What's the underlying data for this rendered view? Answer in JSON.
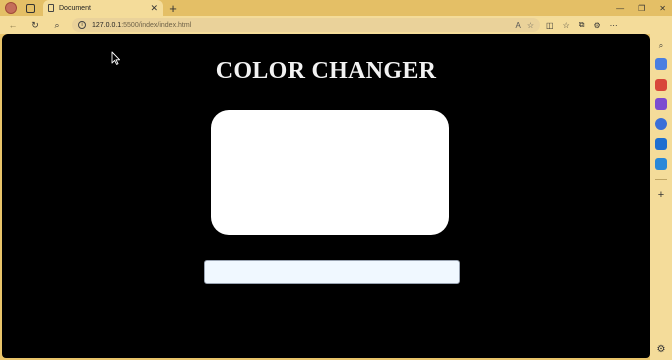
{
  "browser": {
    "tab": {
      "title": "Document",
      "close": "✕"
    },
    "new_tab": "+",
    "window_controls": {
      "minimize": "—",
      "restore": "❐",
      "close": "✕"
    },
    "address": {
      "host": "127.0.0.1",
      "path": ":5500/index/index.html"
    },
    "icons": {
      "profile": "profile-avatar",
      "workspaces": "workspaces-icon",
      "back": "←",
      "reload": "↻",
      "search": "⌕",
      "info": "i",
      "read_aloud": "A",
      "favorite": "☆",
      "split": "◫",
      "favorites_bar": "☆",
      "collections": "⧉",
      "extensions": "⚙",
      "more": "⋯",
      "sidebar_search": "⌕",
      "sidebar_add": "+",
      "sidebar_settings": "⚙"
    }
  },
  "page": {
    "title": "COLOR CHANGER",
    "color_input": {
      "value": "",
      "placeholder": ""
    },
    "box_color": "#ffffff",
    "background": "#000000"
  }
}
